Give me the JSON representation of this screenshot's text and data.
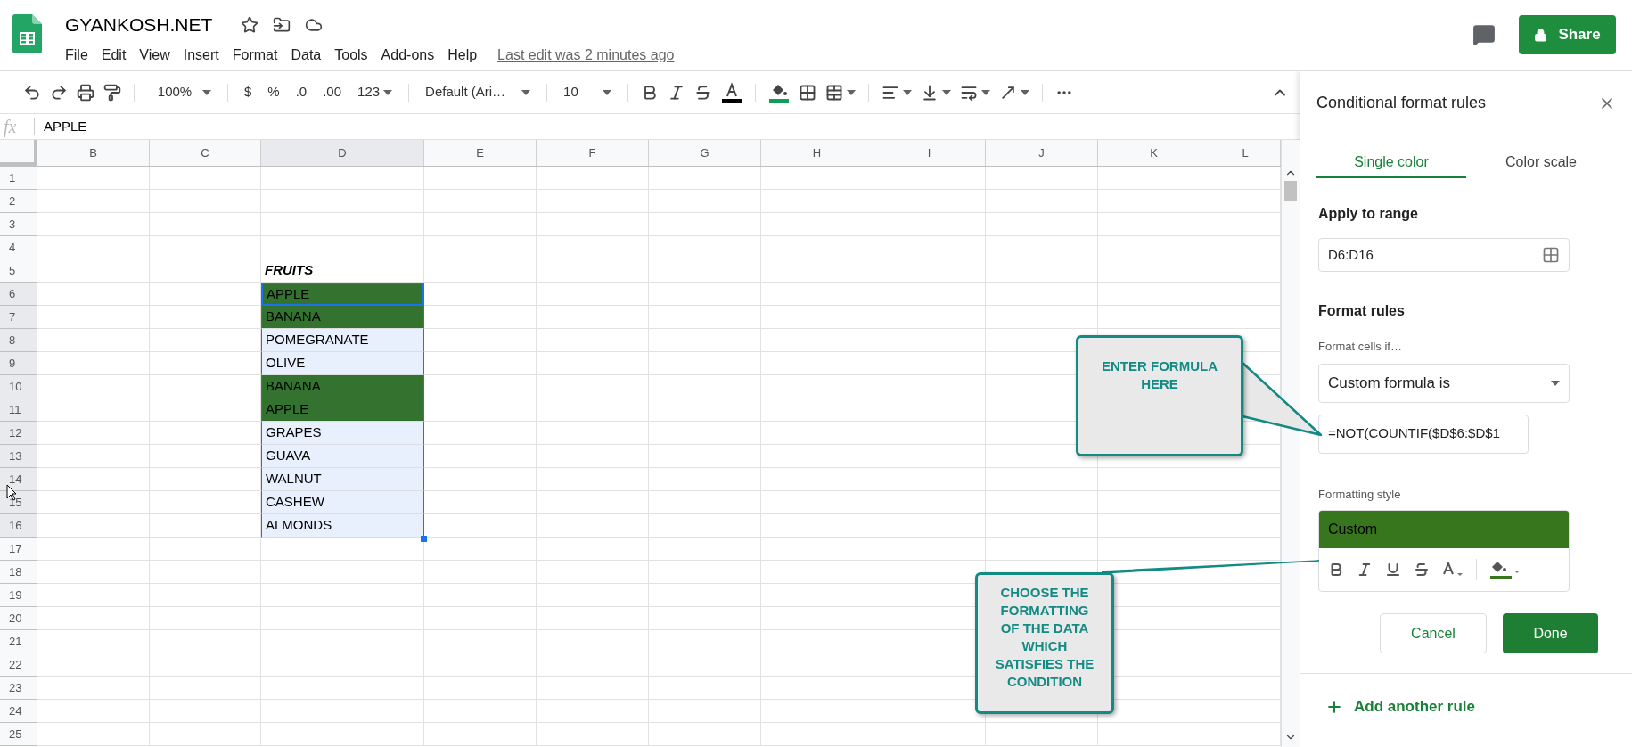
{
  "document": {
    "title": "GYANKOSH.NET",
    "menu": [
      "File",
      "Edit",
      "View",
      "Insert",
      "Format",
      "Data",
      "Tools",
      "Add-ons",
      "Help"
    ],
    "last_edit": "Last edit was 2 minutes ago"
  },
  "share_button": "Share",
  "toolbar": {
    "zoom": "100%",
    "currency": "$",
    "percent": "%",
    "decimal_decrease": ".0",
    "decimal_increase": ".00",
    "number_format": "123",
    "font": "Default (Ari…",
    "font_size": "10"
  },
  "formula_bar": {
    "label": "fx",
    "value": "APPLE"
  },
  "sheet": {
    "columns": [
      {
        "label": "B",
        "selected": false
      },
      {
        "label": "C",
        "selected": false
      },
      {
        "label": "D",
        "selected": true
      },
      {
        "label": "E",
        "selected": false
      },
      {
        "label": "F",
        "selected": false
      },
      {
        "label": "G",
        "selected": false
      },
      {
        "label": "H",
        "selected": false
      },
      {
        "label": "I",
        "selected": false
      },
      {
        "label": "J",
        "selected": false
      },
      {
        "label": "K",
        "selected": false
      },
      {
        "label": "L",
        "selected": false
      }
    ],
    "rows": [
      {
        "number": "1",
        "selected": false
      },
      {
        "number": "2",
        "selected": false
      },
      {
        "number": "3",
        "selected": false
      },
      {
        "number": "4",
        "selected": false
      },
      {
        "number": "5",
        "selected": false,
        "cell": {
          "text": "FRUITS",
          "kind": "header",
          "highlighted": false,
          "active": false
        }
      },
      {
        "number": "6",
        "selected": true,
        "cell": {
          "text": "APPLE",
          "kind": "value",
          "highlighted": true,
          "active": true
        }
      },
      {
        "number": "7",
        "selected": true,
        "cell": {
          "text": "BANANA",
          "kind": "value",
          "highlighted": true,
          "active": false
        }
      },
      {
        "number": "8",
        "selected": true,
        "cell": {
          "text": "POMEGRANATE",
          "kind": "value",
          "highlighted": false,
          "active": false
        }
      },
      {
        "number": "9",
        "selected": true,
        "cell": {
          "text": "OLIVE",
          "kind": "value",
          "highlighted": false,
          "active": false
        }
      },
      {
        "number": "10",
        "selected": true,
        "cell": {
          "text": "BANANA",
          "kind": "value",
          "highlighted": true,
          "active": false
        }
      },
      {
        "number": "11",
        "selected": true,
        "cell": {
          "text": "APPLE",
          "kind": "value",
          "highlighted": true,
          "active": false
        }
      },
      {
        "number": "12",
        "selected": true,
        "cell": {
          "text": "GRAPES",
          "kind": "value",
          "highlighted": false,
          "active": false
        }
      },
      {
        "number": "13",
        "selected": true,
        "cell": {
          "text": "GUAVA",
          "kind": "value",
          "highlighted": false,
          "active": false
        }
      },
      {
        "number": "14",
        "selected": true,
        "cell": {
          "text": "WALNUT",
          "kind": "value",
          "highlighted": false,
          "active": false
        }
      },
      {
        "number": "15",
        "selected": true,
        "cell": {
          "text": "CASHEW",
          "kind": "value",
          "highlighted": false,
          "active": false
        }
      },
      {
        "number": "16",
        "selected": true,
        "cell": {
          "text": "ALMONDS",
          "kind": "value",
          "highlighted": false,
          "active": false
        }
      },
      {
        "number": "17",
        "selected": false
      },
      {
        "number": "18",
        "selected": false
      },
      {
        "number": "19",
        "selected": false
      },
      {
        "number": "20",
        "selected": false
      },
      {
        "number": "21",
        "selected": false
      },
      {
        "number": "22",
        "selected": false
      },
      {
        "number": "23",
        "selected": false
      },
      {
        "number": "24",
        "selected": false
      },
      {
        "number": "25",
        "selected": false
      }
    ]
  },
  "panel": {
    "title": "Conditional format rules",
    "tabs": [
      {
        "label": "Single color",
        "selected": true
      },
      {
        "label": "Color scale",
        "selected": false
      }
    ],
    "range_label": "Apply to range",
    "range_value": "D6:D16",
    "rules_heading": "Format rules",
    "condition_label": "Format cells if…",
    "condition": "Custom formula is",
    "formula": "=NOT(COUNTIF($D$6:$D$1",
    "style_label": "Formatting style",
    "style_preview": "Custom",
    "cancel_button": "Cancel",
    "done_button": "Done",
    "add_rule": "Add another rule"
  },
  "callouts": [
    {
      "text": "ENTER FORMULA HERE"
    },
    {
      "text": "CHOOSE THE FORMATTING OF THE DATA WHICH SATISFIES THE CONDITION"
    }
  ]
}
